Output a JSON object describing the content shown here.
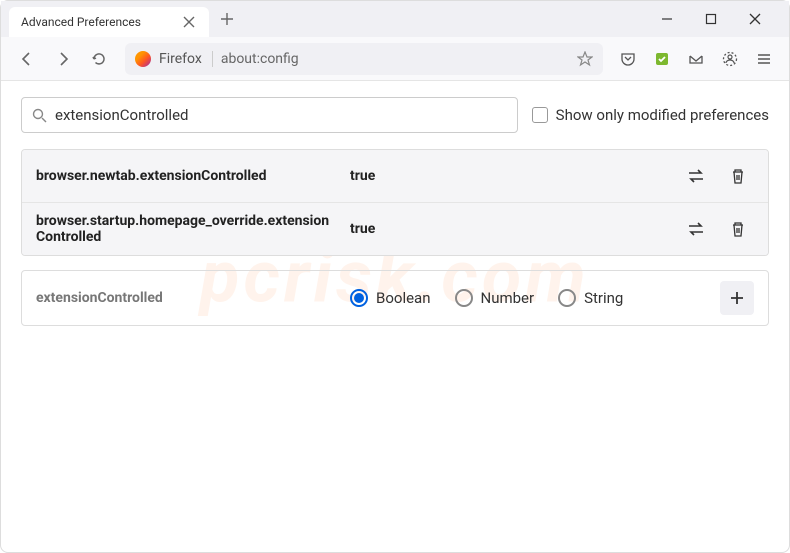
{
  "window": {
    "tab_title": "Advanced Preferences"
  },
  "toolbar": {
    "identity_label": "Firefox",
    "url": "about:config"
  },
  "search": {
    "value": "extensionControlled",
    "show_modified_label": "Show only modified preferences"
  },
  "prefs": [
    {
      "name": "browser.newtab.extensionControlled",
      "value": "true"
    },
    {
      "name": "browser.startup.homepage_override.extensionControlled",
      "value": "true"
    }
  ],
  "newpref": {
    "name": "extensionControlled",
    "types": {
      "boolean": "Boolean",
      "number": "Number",
      "string": "String"
    }
  },
  "watermark": "pcrisk.com"
}
